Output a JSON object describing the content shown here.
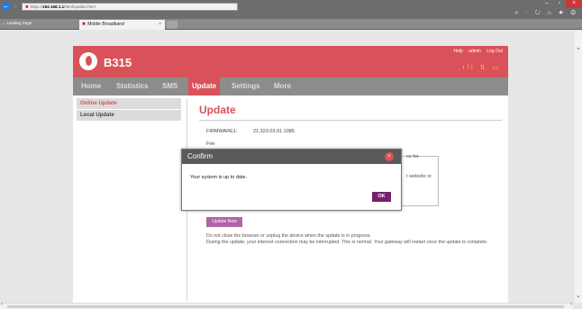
{
  "browser": {
    "address_error": "✖",
    "address_prefix": "https://",
    "address_host": "192.168.1.1",
    "address_path": "/html/update.html",
    "bookmark_label": "Landing Page",
    "tab_label": "Mobile Broadband",
    "tab_close": "×",
    "win_min": "–",
    "win_max": "▫",
    "win_close": "×",
    "toolbar_icons": "⌕ · ↻ ⌂ ★ ⚙"
  },
  "router": {
    "model": "B315",
    "links": [
      "Help",
      "admin",
      "Log Out"
    ],
    "status_icons": ".ıll ⇅ ▭"
  },
  "menu": {
    "items": [
      "Home",
      "Statistics",
      "SMS",
      "Update",
      "Settings",
      "More"
    ],
    "active": "Update"
  },
  "sidebar": {
    "items": [
      "Online Update",
      "Local Update"
    ]
  },
  "content": {
    "title": "Update",
    "firmware_label": "FIRMWARE1:",
    "firmware_value": "21.323.03.01.1085",
    "second_label": "Fire",
    "frag1": "ce for",
    "frag2": "t website or",
    "update_button": "Update Now",
    "note_line1": "Do not close the browser or unplug the device when the update is in progress.",
    "note_line2": "During the update, your internet connection may be interrupted. This is normal. Your gateway will restart once the update is complete."
  },
  "dialog": {
    "title": "Confirm",
    "message": "Your system is up to date.",
    "ok_label": "OK",
    "close_glyph": "×"
  },
  "colors": {
    "brand": "#d9525a",
    "menu_bg": "#8c8c8c",
    "button_purple": "#b063a6",
    "ok_button": "#7a1f6e"
  }
}
